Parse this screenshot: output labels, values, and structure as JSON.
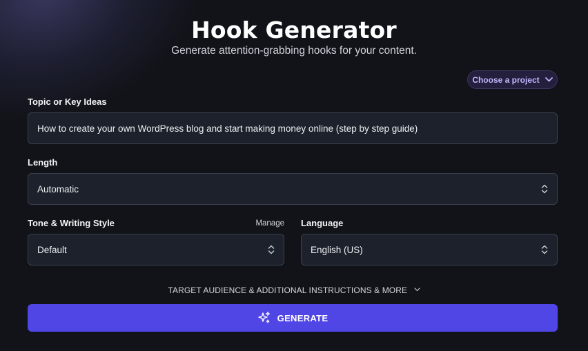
{
  "header": {
    "title": "Hook Generator",
    "subtitle": "Generate attention-grabbing hooks for your content."
  },
  "project_selector": {
    "label": "Choose a project",
    "icon": "chevron-down-icon"
  },
  "topic": {
    "label": "Topic or Key Ideas",
    "value": "How to create your own WordPress blog and start making money online (step by step guide)"
  },
  "length": {
    "label": "Length",
    "value": "Automatic"
  },
  "tone": {
    "label": "Tone & Writing Style",
    "manage_label": "Manage",
    "value": "Default"
  },
  "language": {
    "label": "Language",
    "value": "English (US)"
  },
  "more_options": {
    "label": "TARGET AUDIENCE & ADDITIONAL INSTRUCTIONS & MORE"
  },
  "generate": {
    "label": "GENERATE",
    "icon": "sparkles-icon"
  },
  "colors": {
    "background": "#111318",
    "accent": "#5046e5",
    "project_text": "#c4b5fd",
    "field_bg": "#1c212b",
    "field_border": "#3a414d"
  }
}
